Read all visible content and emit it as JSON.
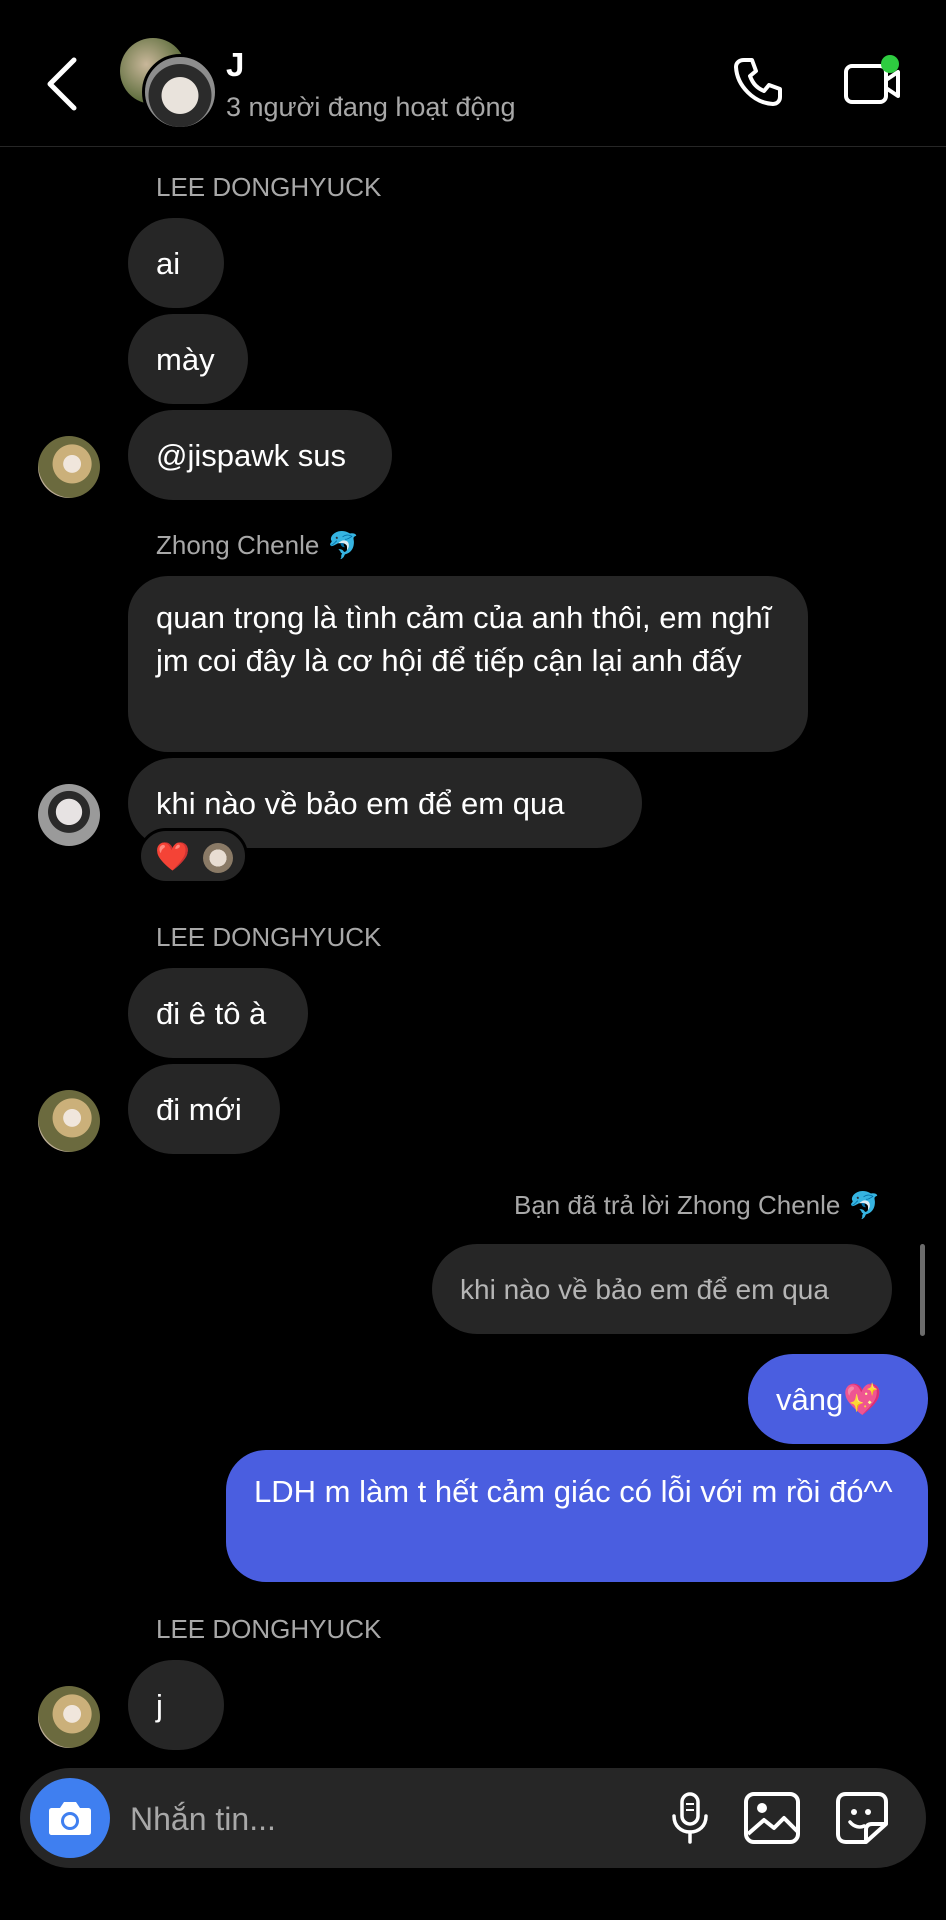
{
  "header": {
    "title": "J",
    "status": "3 người đang hoạt động",
    "back_icon": "chevron-left-icon",
    "call_icon": "phone-icon",
    "video_icon": "video-camera-icon",
    "online_color": "#2ecc40"
  },
  "messages": {
    "group1": {
      "sender": "LEE DONGHYUCK",
      "bubbles": [
        "ai",
        "mày",
        "@jispawk sus"
      ]
    },
    "group2": {
      "sender": "Zhong Chenle",
      "sender_emoji": "🐬",
      "bubbles": [
        "quan trọng là tình cảm của anh thôi, em nghĩ jm coi đây là cơ hội để tiếp cận lại anh đấy",
        "khi nào về bảo em để em qua"
      ],
      "reaction": "❤️"
    },
    "group3": {
      "sender": "LEE DONGHYUCK",
      "bubbles": [
        "đi ê tô à",
        "đi mới"
      ]
    },
    "reply": {
      "label": "Bạn đã trả lời Zhong Chenle",
      "label_emoji": "🐬",
      "quoted": "khi nào về bảo em để em qua"
    },
    "mine": [
      "vâng💖",
      "LDH m làm t hết cảm giác có lỗi với m rồi đó^^"
    ],
    "group4": {
      "sender": "LEE DONGHYUCK",
      "bubbles": [
        "j"
      ]
    }
  },
  "composer": {
    "placeholder": "Nhắn tin...",
    "camera_icon": "camera-icon",
    "mic_icon": "microphone-icon",
    "gallery_icon": "image-icon",
    "sticker_icon": "sticker-icon",
    "camera_color": "#3f7ff0"
  },
  "colors": {
    "my_bubble": "#4a5ee0",
    "their_bubble": "#262626",
    "background": "#000000"
  }
}
